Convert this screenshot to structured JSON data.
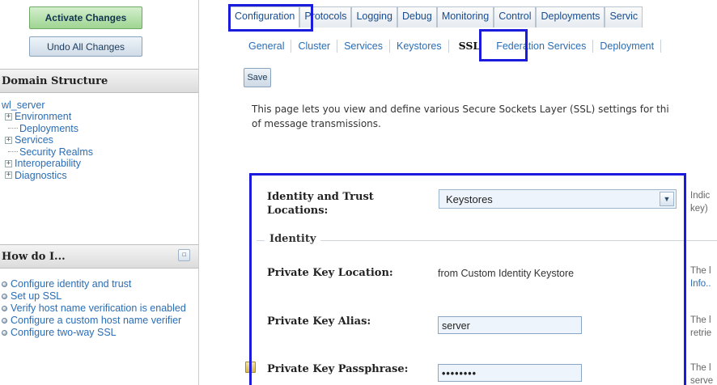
{
  "left_panel": {
    "activate_label": "Activate Changes",
    "undo_label": "Undo All Changes",
    "domain_structure": {
      "title": "Domain Structure",
      "root": "wl_server",
      "items": [
        {
          "label": "Environment",
          "expandable": true
        },
        {
          "label": "Deployments",
          "expandable": false
        },
        {
          "label": "Services",
          "expandable": true
        },
        {
          "label": "Security Realms",
          "expandable": false
        },
        {
          "label": "Interoperability",
          "expandable": true
        },
        {
          "label": "Diagnostics",
          "expandable": true
        }
      ]
    },
    "how_do_i": {
      "title": "How do I...",
      "items": [
        "Configure identity and trust",
        "Set up SSL",
        "Verify host name verification is enabled",
        "Configure a custom host name verifier",
        "Configure two-way SSL"
      ]
    }
  },
  "tabs_primary": [
    "Configuration",
    "Protocols",
    "Logging",
    "Debug",
    "Monitoring",
    "Control",
    "Deployments",
    "Servic"
  ],
  "tabs_secondary": [
    "General",
    "Cluster",
    "Services",
    "Keystores",
    "SSL",
    "Federation Services",
    "Deployment"
  ],
  "active_primary": "Configuration",
  "active_secondary": "SSL",
  "save_label": "Save",
  "intro": {
    "line1": "This page lets you view and define various Secure Sockets Layer (SSL) settings for thi",
    "line2": "of message transmissions."
  },
  "form": {
    "identity_trust": {
      "label": "Identity and Trust Locations:",
      "value": "Keystores",
      "desc_line1": "Indic",
      "desc_line2": "key)"
    },
    "section_identity": "Identity",
    "private_key_location": {
      "label": "Private Key Location:",
      "value": "from Custom Identity Keystore",
      "desc_line1": "The l",
      "desc_link": "Info.."
    },
    "private_key_alias": {
      "label": "Private Key Alias:",
      "value": "server",
      "desc_line1": "The l",
      "desc_line2": "retrie"
    },
    "private_key_passphrase": {
      "label": "Private Key Passphrase:",
      "value": "••••••••",
      "desc_line1": "The l",
      "desc_line2": "serve"
    }
  },
  "colors": {
    "highlight_box": "#1b1bde",
    "link": "#2a6db5",
    "activate_green": "#9fd592"
  }
}
